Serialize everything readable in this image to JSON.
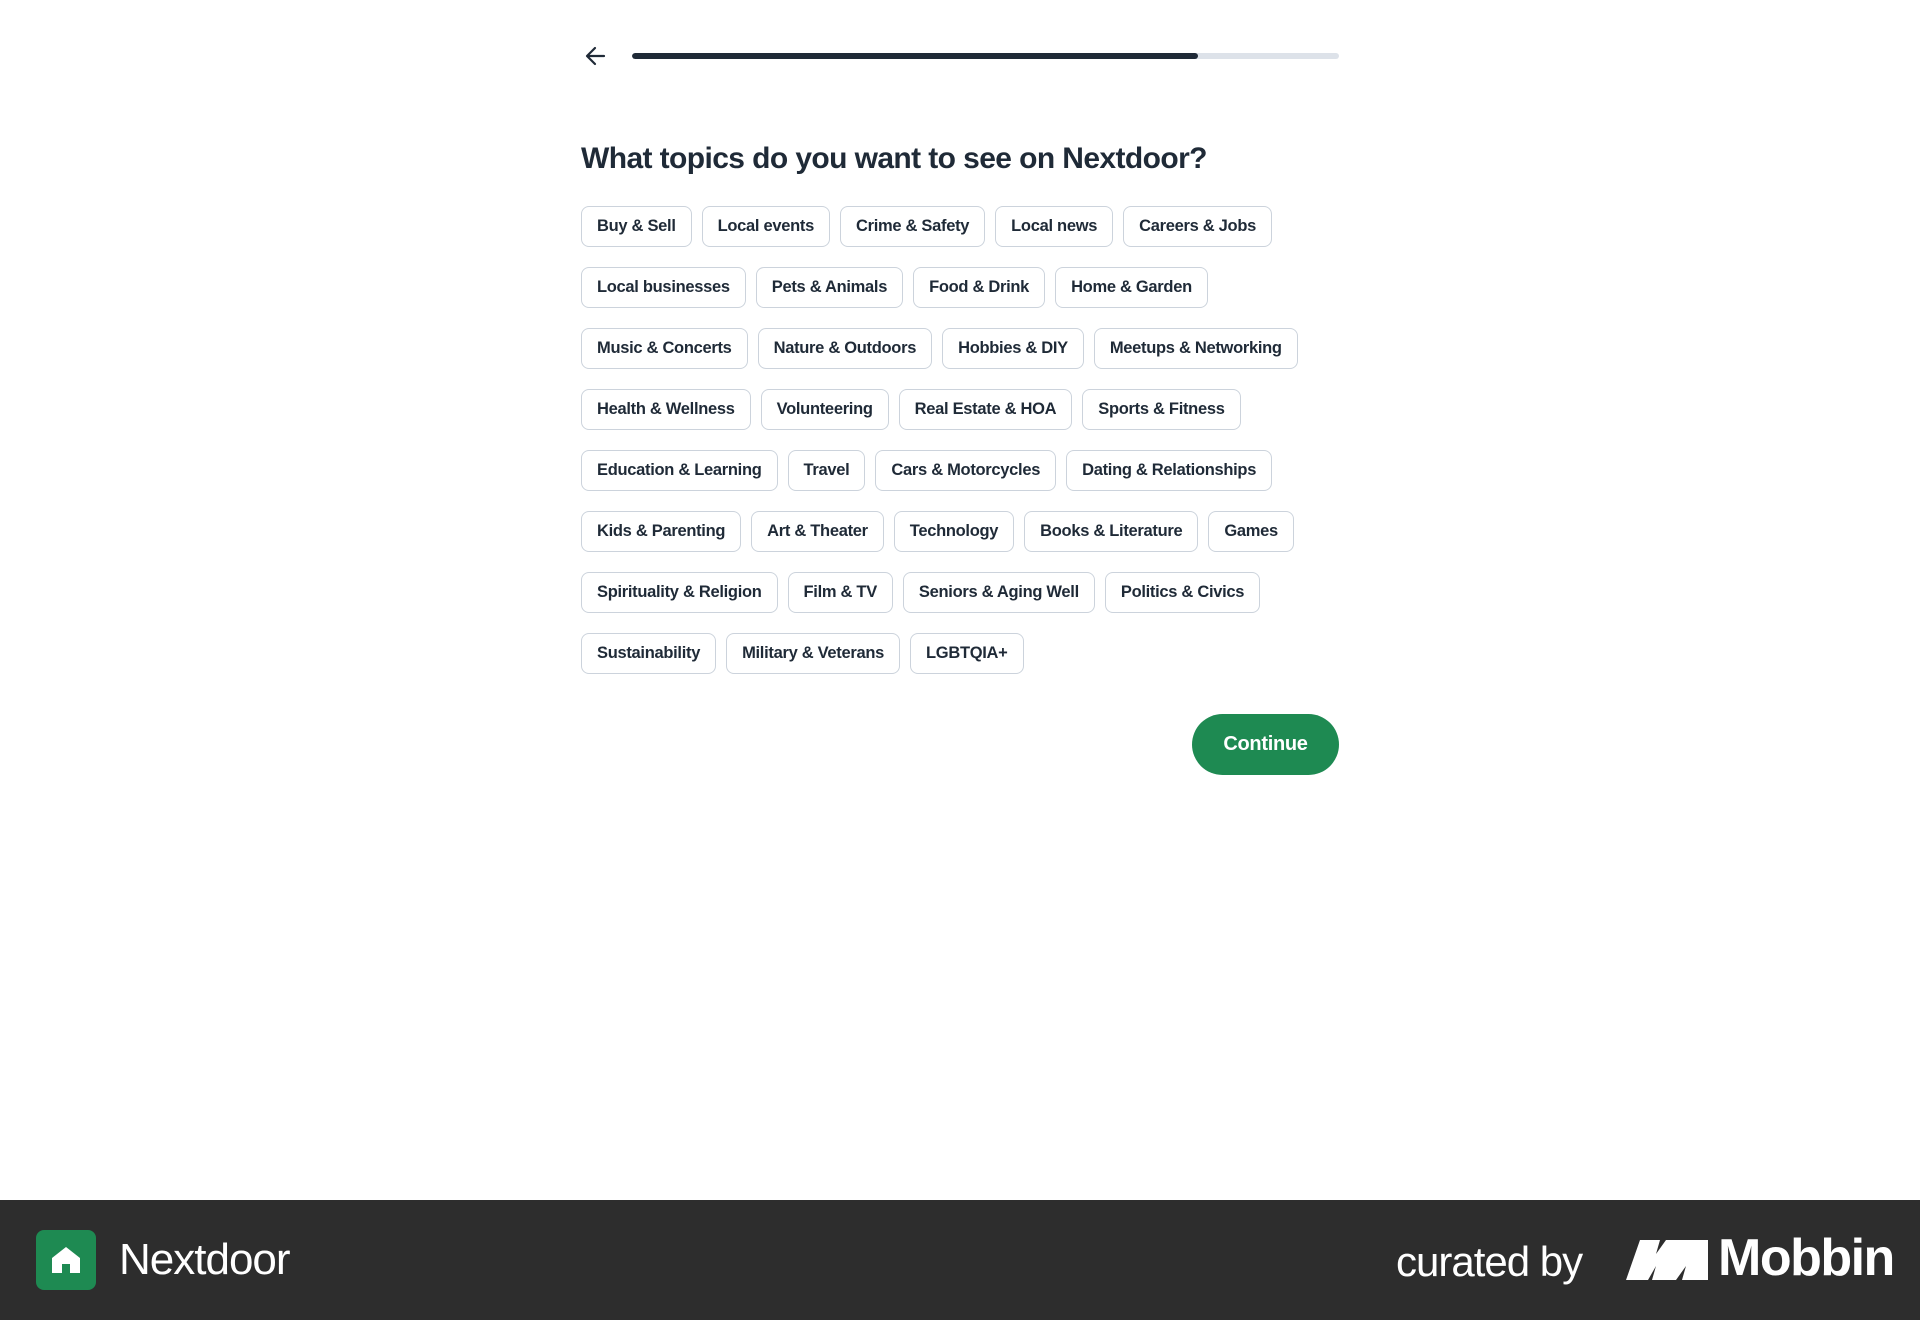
{
  "header": {
    "back_icon": "arrow-left-icon",
    "progress_fraction": 0.8
  },
  "title": "What topics do you want to see on Nextdoor?",
  "topic_rows": [
    [
      "Buy & Sell",
      "Local events",
      "Crime & Safety",
      "Local news",
      "Careers & Jobs"
    ],
    [
      "Local businesses",
      "Pets & Animals",
      "Food & Drink",
      "Home & Garden"
    ],
    [
      "Music & Concerts",
      "Nature & Outdoors",
      "Hobbies & DIY",
      "Meetups & Networking"
    ],
    [
      "Health & Wellness",
      "Volunteering",
      "Real Estate & HOA",
      "Sports & Fitness"
    ],
    [
      "Education & Learning",
      "Travel",
      "Cars & Motorcycles",
      "Dating & Relationships"
    ],
    [
      "Kids & Parenting",
      "Art & Theater",
      "Technology",
      "Books & Literature",
      "Games"
    ],
    [
      "Spirituality & Religion",
      "Film & TV",
      "Seniors & Aging Well",
      "Politics & Civics"
    ],
    [
      "Sustainability",
      "Military & Veterans",
      "LGBTQIA+"
    ]
  ],
  "continue_label": "Continue",
  "footer": {
    "app_name": "Nextdoor",
    "app_icon": "nextdoor-house-icon",
    "curated_by": "curated by",
    "curator_name": "Mobbin",
    "curator_icon": "mobbin-logo-icon"
  },
  "colors": {
    "accent": "#1e8a52",
    "text": "#1f2a37",
    "chip_border": "#ccd3dc",
    "progress_track": "#dde2e9",
    "footer_bg": "#2d2d2d"
  }
}
